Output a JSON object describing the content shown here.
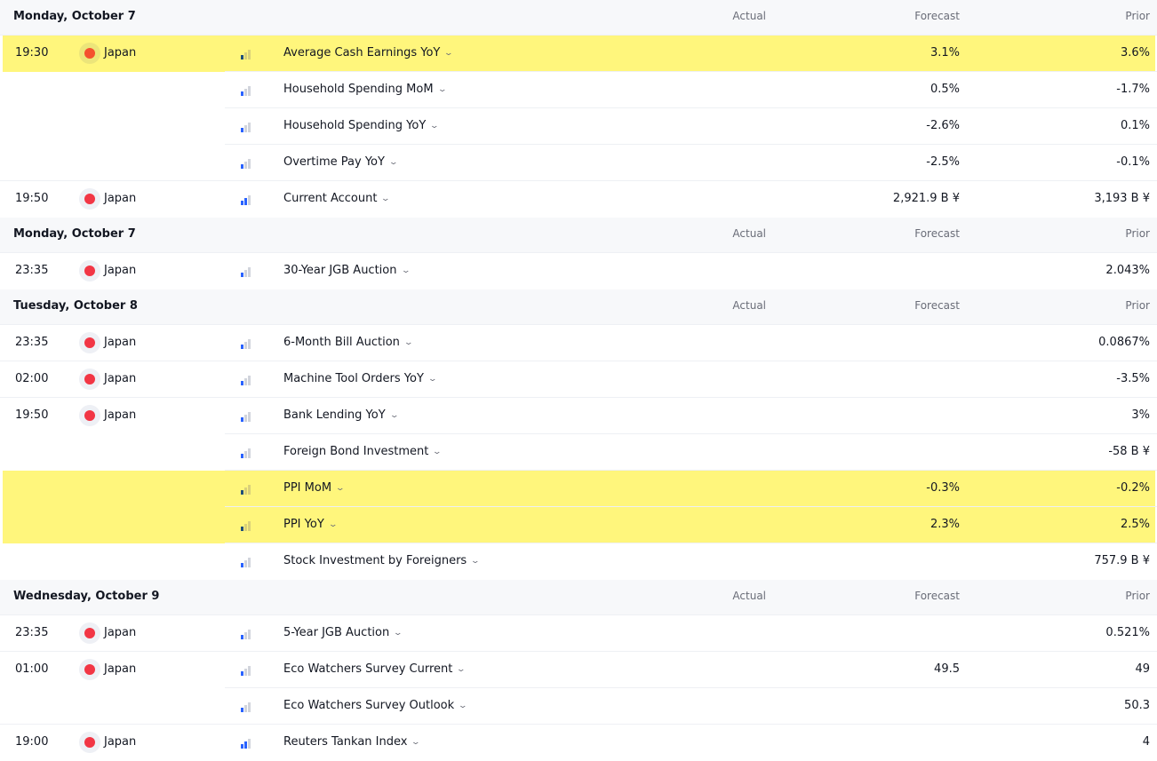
{
  "columns": {
    "actual": "Actual",
    "forecast": "Forecast",
    "prior": "Prior"
  },
  "colors": {
    "highlight": "#fff67c",
    "importance_on": "#2962ff",
    "importance_off": "#d1d4dc",
    "flag_dot": "#f23645",
    "header_bg": "#f7f8fa"
  },
  "groups": [
    {
      "date": "Monday, October 7",
      "events": [
        {
          "time": "19:30",
          "country": "Japan",
          "importance": 1,
          "name": "Average Cash Earnings YoY",
          "actual": "",
          "forecast": "3.1%",
          "prior": "3.6%",
          "highlight": true,
          "sep": "sub"
        },
        {
          "time": "",
          "country": "",
          "importance": 1,
          "name": "Household Spending MoM",
          "actual": "",
          "forecast": "0.5%",
          "prior": "-1.7%",
          "highlight": false,
          "sep": "sub"
        },
        {
          "time": "",
          "country": "",
          "importance": 1,
          "name": "Household Spending YoY",
          "actual": "",
          "forecast": "-2.6%",
          "prior": "0.1%",
          "highlight": false,
          "sep": "sub"
        },
        {
          "time": "",
          "country": "",
          "importance": 1,
          "name": "Overtime Pay YoY",
          "actual": "",
          "forecast": "-2.5%",
          "prior": "-0.1%",
          "highlight": false,
          "sep": "full"
        },
        {
          "time": "19:50",
          "country": "Japan",
          "importance": 2,
          "name": "Current Account",
          "actual": "",
          "forecast": "2,921.9 B ¥",
          "prior": "3,193 B ¥",
          "highlight": false,
          "sep": "none"
        }
      ]
    },
    {
      "date": "Monday, October 7",
      "events": [
        {
          "time": "23:35",
          "country": "Japan",
          "importance": 1,
          "name": "30-Year JGB Auction",
          "actual": "",
          "forecast": "",
          "prior": "2.043%",
          "highlight": false,
          "sep": "none"
        }
      ]
    },
    {
      "date": "Tuesday, October 8",
      "events": [
        {
          "time": "23:35",
          "country": "Japan",
          "importance": 1,
          "name": "6-Month Bill Auction",
          "actual": "",
          "forecast": "",
          "prior": "0.0867%",
          "highlight": false,
          "sep": "full"
        },
        {
          "time": "02:00",
          "country": "Japan",
          "importance": 1,
          "name": "Machine Tool Orders YoY",
          "actual": "",
          "forecast": "",
          "prior": "-3.5%",
          "highlight": false,
          "sep": "full"
        },
        {
          "time": "19:50",
          "country": "Japan",
          "importance": 1,
          "name": "Bank Lending YoY",
          "actual": "",
          "forecast": "",
          "prior": "3%",
          "highlight": false,
          "sep": "sub"
        },
        {
          "time": "",
          "country": "",
          "importance": 1,
          "name": "Foreign Bond Investment",
          "actual": "",
          "forecast": "",
          "prior": "-58 B ¥",
          "highlight": false,
          "sep": "sub"
        },
        {
          "time": "",
          "country": "",
          "importance": 1,
          "name": "PPI MoM",
          "actual": "",
          "forecast": "-0.3%",
          "prior": "-0.2%",
          "highlight": true,
          "sep": "sub"
        },
        {
          "time": "",
          "country": "",
          "importance": 1,
          "name": "PPI YoY",
          "actual": "",
          "forecast": "2.3%",
          "prior": "2.5%",
          "highlight": true,
          "sep": "sub"
        },
        {
          "time": "",
          "country": "",
          "importance": 1,
          "name": "Stock Investment by Foreigners",
          "actual": "",
          "forecast": "",
          "prior": "757.9 B ¥",
          "highlight": false,
          "sep": "none"
        }
      ]
    },
    {
      "date": "Wednesday, October 9",
      "events": [
        {
          "time": "23:35",
          "country": "Japan",
          "importance": 1,
          "name": "5-Year JGB Auction",
          "actual": "",
          "forecast": "",
          "prior": "0.521%",
          "highlight": false,
          "sep": "full"
        },
        {
          "time": "01:00",
          "country": "Japan",
          "importance": 1,
          "name": "Eco Watchers Survey Current",
          "actual": "",
          "forecast": "49.5",
          "prior": "49",
          "highlight": false,
          "sep": "sub"
        },
        {
          "time": "",
          "country": "",
          "importance": 1,
          "name": "Eco Watchers Survey Outlook",
          "actual": "",
          "forecast": "",
          "prior": "50.3",
          "highlight": false,
          "sep": "full"
        },
        {
          "time": "19:00",
          "country": "Japan",
          "importance": 2,
          "name": "Reuters Tankan Index",
          "actual": "",
          "forecast": "",
          "prior": "4",
          "highlight": false,
          "sep": "none"
        }
      ]
    }
  ]
}
